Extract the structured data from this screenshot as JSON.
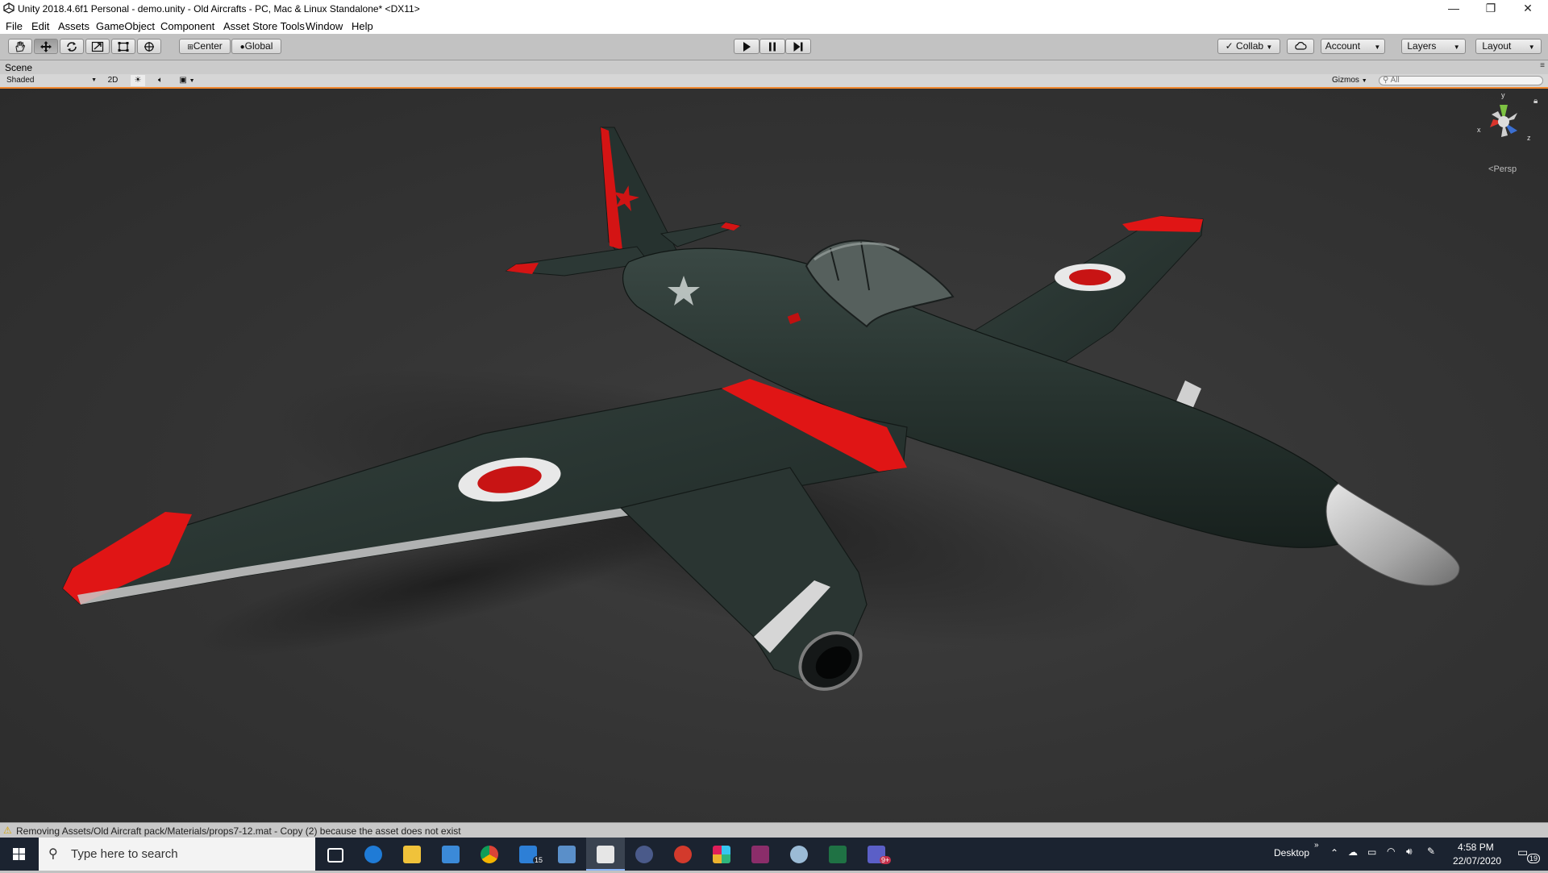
{
  "window": {
    "title": "Unity 2018.4.6f1 Personal - demo.unity - Old Aircrafts - PC, Mac & Linux Standalone* <DX11>",
    "controls": [
      "—",
      "❐",
      "✕"
    ]
  },
  "menu": [
    "File",
    "Edit",
    "Assets",
    "GameObject",
    "Component",
    "Asset Store Tools",
    "Window",
    "Help"
  ],
  "toolbar": {
    "tools": [
      "hand-tool",
      "move-tool",
      "rotate-tool",
      "scale-tool",
      "rect-tool",
      "transform-tool"
    ],
    "pivot_mode": "Center",
    "pivot_rotation": "Global",
    "collab": "Collab",
    "account": "Account",
    "layers": "Layers",
    "layout": "Layout"
  },
  "scene": {
    "tab_label": "Scene",
    "shading_mode": "Shaded",
    "mode_2d": "2D",
    "gizmos": "Gizmos",
    "search_placeholder": "All",
    "projection": "Persp",
    "gizmo_axes": {
      "x": "x",
      "y": "y",
      "z": "z"
    },
    "colors": {
      "accent": "#f0862d",
      "wing_red": "#e01515",
      "body": "#263530"
    }
  },
  "status": {
    "message": "Removing Assets/Old Aircraft pack/Materials/props7-12.mat - Copy (2) because the asset does not exist"
  },
  "taskbar": {
    "search_placeholder": "Type here to search",
    "apps": [
      "task-view",
      "edge",
      "file-explorer",
      "store",
      "chrome",
      "mail",
      "remote-desktop",
      "unity",
      "blender",
      "screenpresso",
      "slack",
      "winrar",
      "paint",
      "excel",
      "teams"
    ],
    "mail_badge": "15",
    "teams_badge": "9+",
    "desktop_label": "Desktop",
    "time": "4:58 PM",
    "date": "22/07/2020",
    "notifications_badge": "19"
  }
}
